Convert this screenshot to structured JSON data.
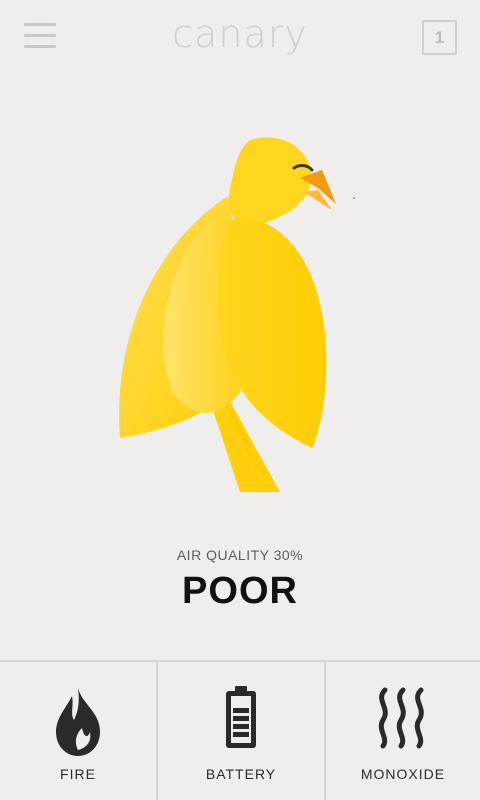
{
  "header": {
    "title": "canary",
    "menu_icon": "hamburger-menu-icon",
    "notification_count": "1"
  },
  "status": {
    "air_quality_label": "AIR QUALITY 30%",
    "air_quality_value": 30,
    "air_quality_rating": "POOR"
  },
  "tabs": [
    {
      "label": "FIRE",
      "icon": "flame-icon"
    },
    {
      "label": "BATTERY",
      "icon": "battery-icon"
    },
    {
      "label": "MONOXIDE",
      "icon": "smoke-waves-icon"
    }
  ],
  "colors": {
    "background": "#efeeec",
    "canary_yellow": "#ffd21a",
    "canary_beak": "#f29a12",
    "text_dark": "#111111",
    "divider": "#d4d4d2"
  }
}
